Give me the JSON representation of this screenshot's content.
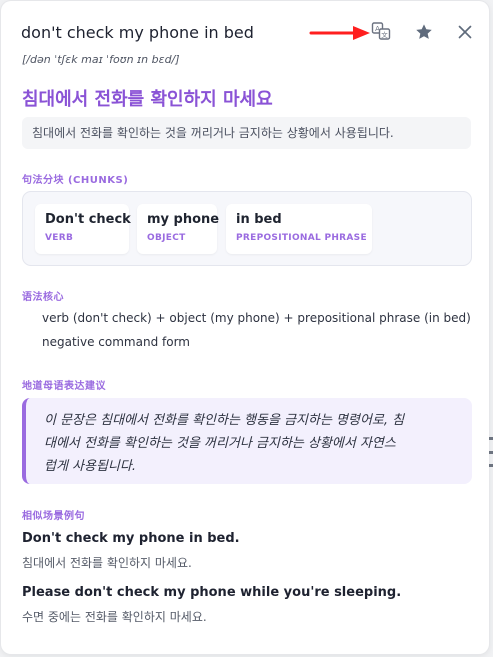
{
  "header": {
    "phrase": "don't check my phone in bed",
    "phonetic": "[/dən ˈtʃɛk maɪ ˈfoʊn ɪn bɛd/]",
    "icons": [
      "translate-icon",
      "star-icon",
      "close-icon"
    ],
    "annotation_arrow_color": "#ff1f1f"
  },
  "translation": "침대에서 전화를 확인하지 마세요",
  "usage_note": "침대에서 전화를 확인하는 것을 꺼리거나 금지하는 상황에서 사용됩니다.",
  "chunks_section": {
    "title": "句法分块 (CHUNKS)",
    "chunks": [
      {
        "text": "Don't check",
        "tag": "VERB"
      },
      {
        "text": "my phone",
        "tag": "OBJECT"
      },
      {
        "text": "in bed",
        "tag": "PREPOSITIONAL PHRASE"
      }
    ]
  },
  "grammar_section": {
    "title": "语法核心",
    "lines": [
      "verb (don't check) + object (my phone) + prepositional phrase (in bed)",
      "negative command form"
    ]
  },
  "suggestion_section": {
    "title": "地道母语表达建议",
    "lines": [
      "이 문장은 침대에서 전화를 확인하는 행동을 금지하는 명령어로, 침",
      "대에서 전화를 확인하는 것을 꺼리거나 금지하는 상황에서 자연스",
      "럽게 사용됩니다."
    ]
  },
  "examples_section": {
    "title": "相似场景例句",
    "examples": [
      {
        "en": "Don't check my phone in bed.",
        "ko": "침대에서 전화를 확인하지 마세요."
      },
      {
        "en": "Please don't check my phone while you're sleeping.",
        "ko": "수면 중에는 전화를 확인하지 마세요."
      }
    ]
  },
  "colors": {
    "accent": "#8a53d6",
    "section_title": "#9a6be0",
    "suggestion_bg": "#f3f0fd"
  }
}
